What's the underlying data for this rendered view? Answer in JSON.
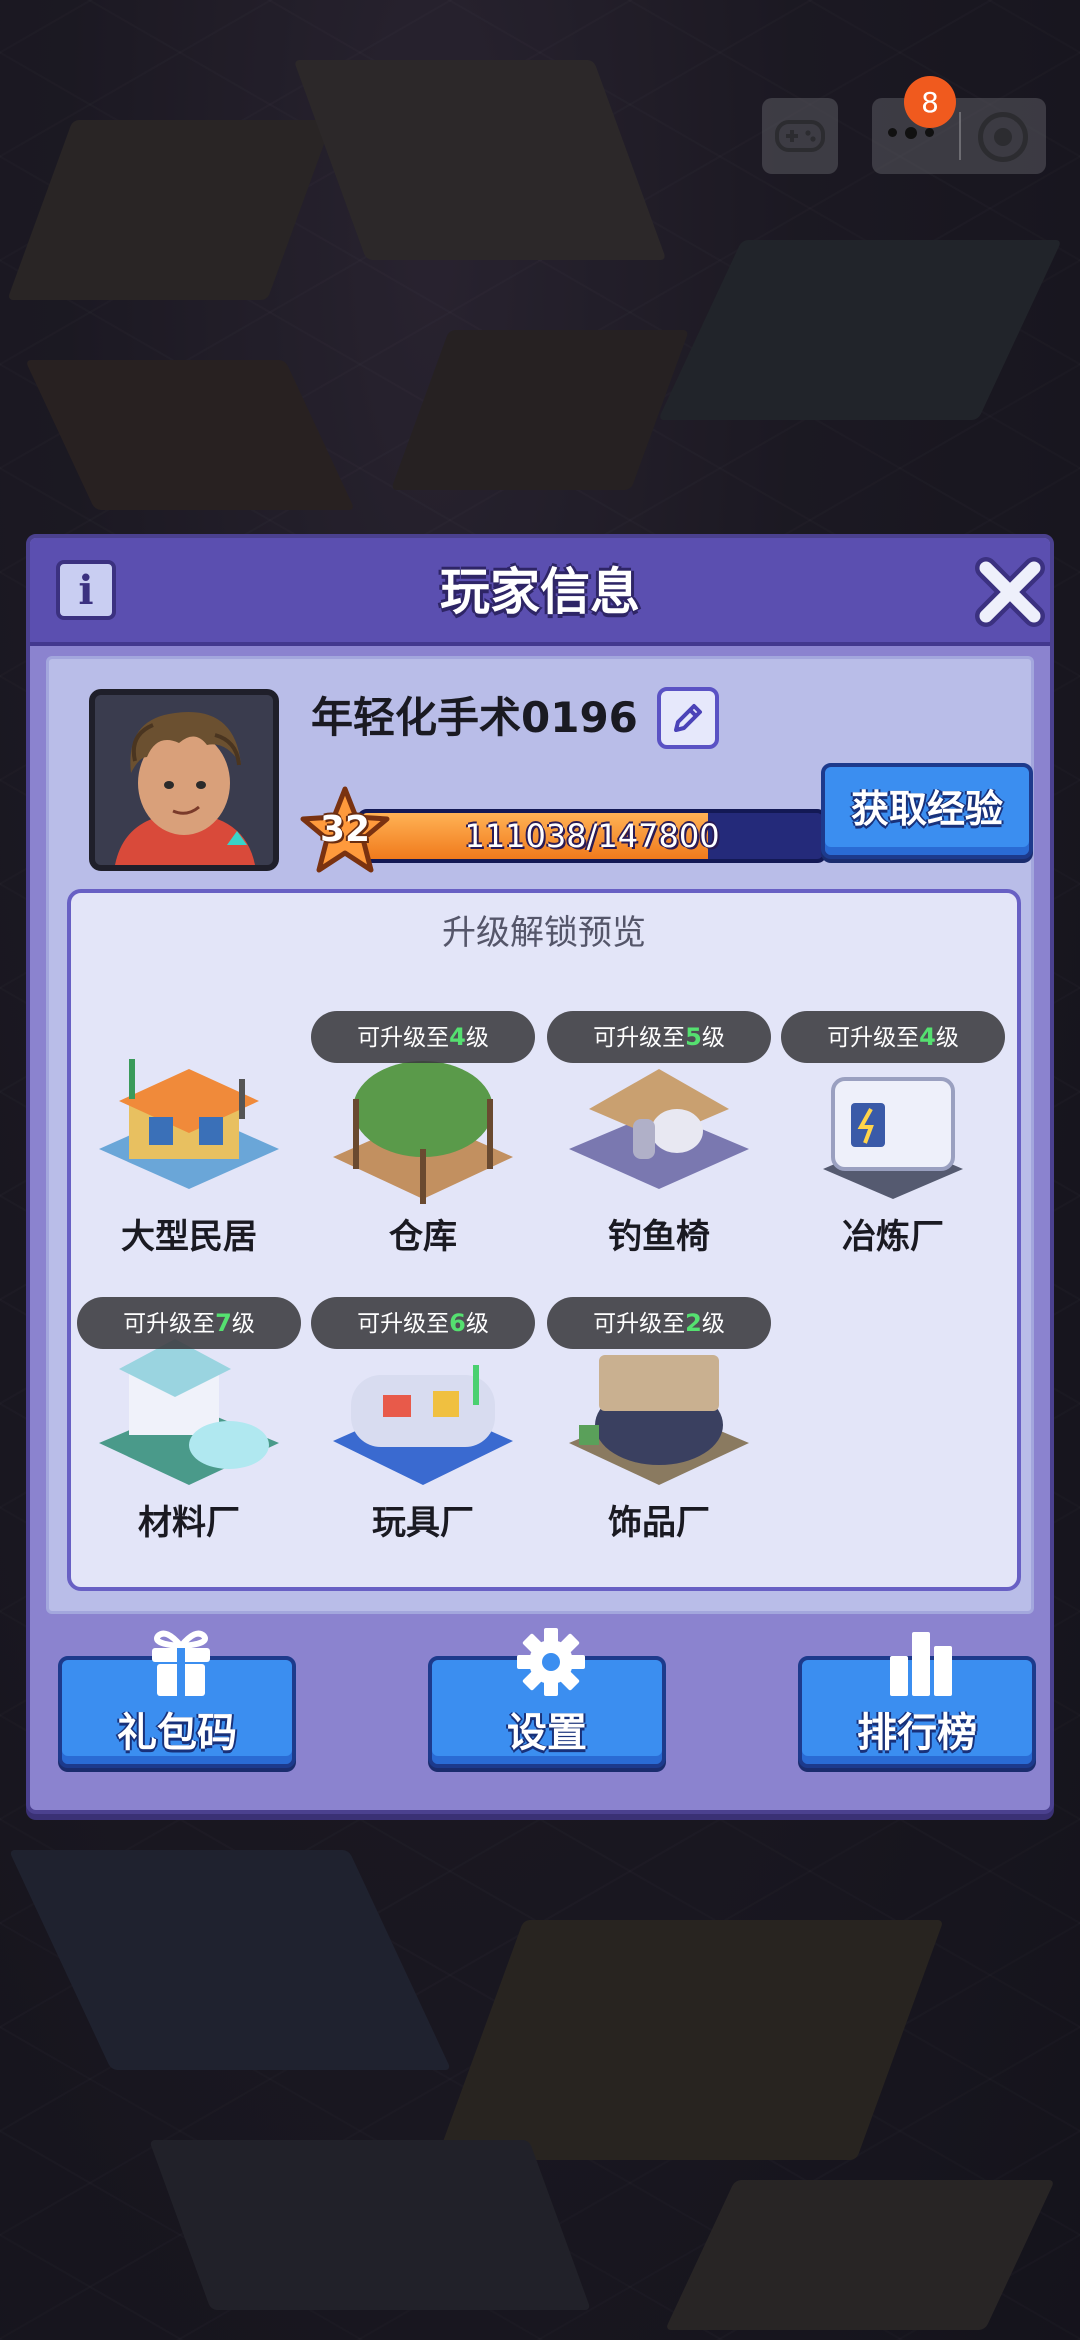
{
  "notification_badge": "8",
  "modal": {
    "title": "玩家信息",
    "info_icon": "i"
  },
  "player": {
    "name": "年轻化手术0196",
    "level": "32",
    "xp_text": "111038/147800",
    "xp_progress": 0.751
  },
  "get_exp_button": "获取经验",
  "unlock_preview": {
    "title": "升级解锁预览",
    "upgrade_prefix": "可升级至",
    "upgrade_suffix": "级",
    "buildings": [
      {
        "name": "大型民居",
        "upgrade_level": null
      },
      {
        "name": "仓库",
        "upgrade_level": "4"
      },
      {
        "name": "钓鱼椅",
        "upgrade_level": "5"
      },
      {
        "name": "冶炼厂",
        "upgrade_level": "4"
      },
      {
        "name": "材料厂",
        "upgrade_level": "7"
      },
      {
        "name": "玩具厂",
        "upgrade_level": "6"
      },
      {
        "name": "饰品厂",
        "upgrade_level": "2"
      }
    ]
  },
  "bottom_buttons": {
    "gift_code": "礼包码",
    "settings": "设置",
    "leaderboard": "排行榜"
  },
  "colors": {
    "modal_header": "#5b4fb0",
    "modal_body": "#8b83cf",
    "button_blue": "#3b8ef0",
    "xp_fill": "#f07a1c",
    "badge": "#f05a1e",
    "upgrade_number": "#55e070"
  }
}
